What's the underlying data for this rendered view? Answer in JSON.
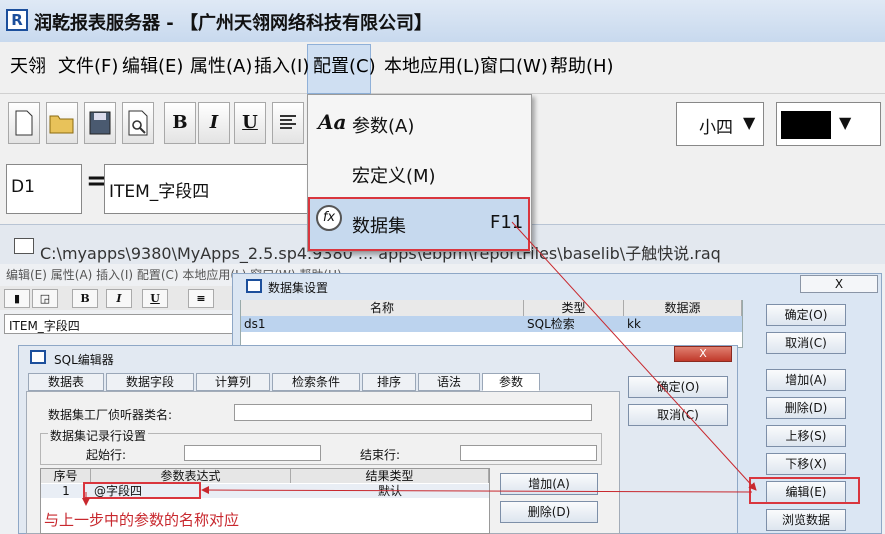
{
  "app": {
    "title": "润乾报表服务器 - 【广州天翎网络科技有限公司】",
    "icon_text": "R"
  },
  "menu": {
    "items": [
      "天翎",
      "文件(F)",
      "编辑(E)",
      "属性(A)",
      "插入(I)",
      "配置(C)",
      "本地应用(L)",
      "窗口(W)",
      "帮助(H)"
    ],
    "open_item": "配置(C)"
  },
  "config_menu": {
    "items": [
      {
        "label": "参数(A)",
        "icon": "Aa",
        "shortcut": ""
      },
      {
        "label": "宏定义(M)",
        "icon": "",
        "shortcut": ""
      },
      {
        "label": "数据集",
        "icon": "dataset-icon",
        "shortcut": "F11"
      }
    ]
  },
  "toolbar": {
    "bold": "B",
    "italic": "I",
    "underline": "U",
    "font_size": "小四"
  },
  "formula_bar": {
    "cell_ref": "D1",
    "equals": "=",
    "formula": "ITEM_字段四"
  },
  "path_bar": {
    "path": "C:\\myapps\\9380\\MyApps_2.5.sp4.9380 ... apps\\ebpm\\reportFiles\\baselib\\子触快说.raq"
  },
  "lower_window": {
    "menu_text": "编辑(E)   属性(A)   插入(I)   配置(C)   本地应用(L)   窗口(W)   帮助(H)",
    "formula": "ITEM_字段四"
  },
  "dataset_dialog": {
    "title": "数据集设置",
    "columns": [
      "名称",
      "类型",
      "数据源"
    ],
    "rows": [
      {
        "name": "ds1",
        "type": "SQL检索",
        "source": "kk"
      }
    ],
    "buttons": [
      "确定(O)",
      "取消(C)",
      "增加(A)",
      "删除(D)",
      "上移(S)",
      "下移(X)",
      "编辑(E)",
      "浏览数据"
    ],
    "close": "X"
  },
  "sql_dialog": {
    "title": "SQL编辑器",
    "tabs": [
      "数据表",
      "数据字段",
      "计算列",
      "检索条件",
      "排序",
      "语法",
      "参数"
    ],
    "active_tab": "参数",
    "buttons": [
      "确定(O)",
      "取消(C)"
    ],
    "listener_label": "数据集工厂侦听器类名:",
    "record_group": "数据集记录行设置",
    "start_label": "起始行:",
    "end_label": "结束行:",
    "param_columns": [
      "序号",
      "参数表达式",
      "结果类型"
    ],
    "param_rows": [
      {
        "index": "1",
        "expr": "@字段四",
        "type": "默认"
      }
    ],
    "param_buttons": [
      "增加(A)",
      "删除(D)"
    ],
    "close": "X"
  },
  "annotation": {
    "note": "与上一步中的参数的名称对应",
    "color": "#c8282e"
  }
}
